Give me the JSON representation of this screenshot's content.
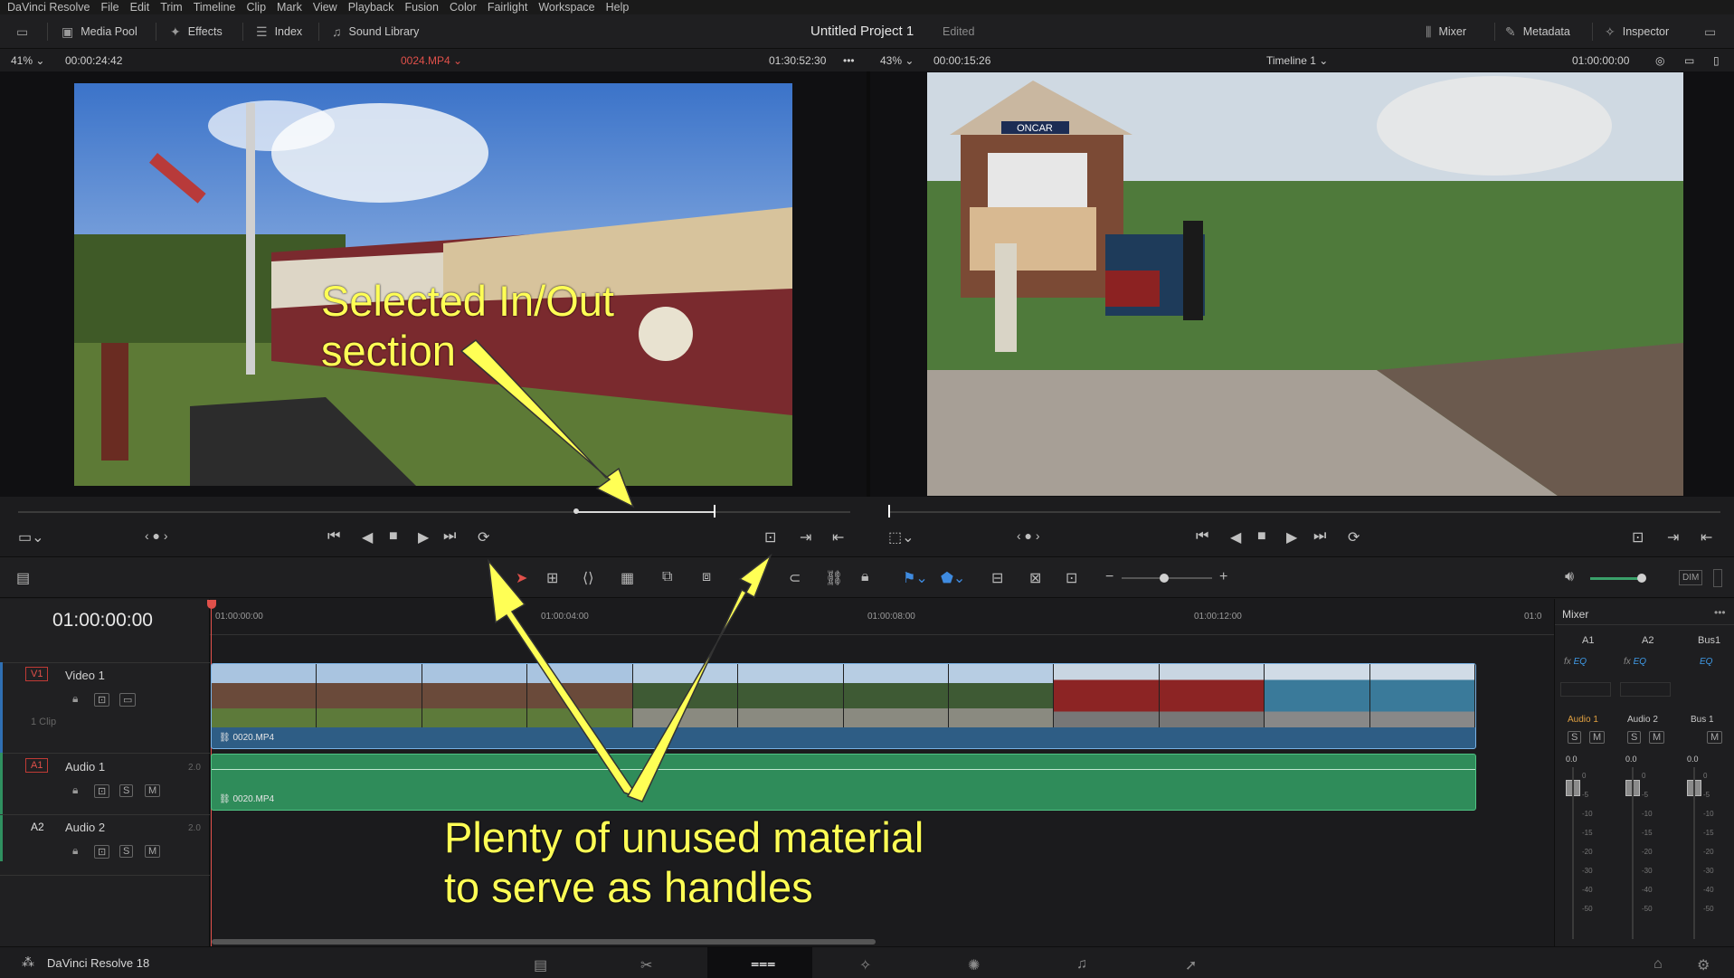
{
  "menu": [
    "DaVinci Resolve",
    "File",
    "Edit",
    "Trim",
    "Timeline",
    "Clip",
    "Mark",
    "View",
    "Playback",
    "Fusion",
    "Color",
    "Fairlight",
    "Workspace",
    "Help"
  ],
  "toolbar": {
    "media_pool": "Media Pool",
    "effects": "Effects",
    "index": "Index",
    "sound_library": "Sound Library",
    "project_title": "Untitled Project 1",
    "project_status": "Edited",
    "mixer": "Mixer",
    "metadata": "Metadata",
    "inspector": "Inspector"
  },
  "source_viewer": {
    "zoom": "41%",
    "duration": "00:00:24:42",
    "clip_name": "0024.MP4",
    "timecode": "01:30:52:30"
  },
  "timeline_viewer": {
    "zoom": "43%",
    "duration": "00:00:15:26",
    "timeline_name": "Timeline 1",
    "timecode": "01:00:00:00",
    "sign_text": "ONCAR"
  },
  "timeline": {
    "current_timecode": "01:00:00:00",
    "ruler_marks": [
      "01:00:00:00",
      "01:00:04:00",
      "01:00:08:00",
      "01:00:12:00",
      "01:0"
    ],
    "tracks": [
      {
        "id": "V1",
        "name": "Video 1",
        "info": "1 Clip",
        "clip": "0020.MP4"
      },
      {
        "id": "A1",
        "name": "Audio 1",
        "level": "2.0",
        "clip": "0020.MP4"
      },
      {
        "id": "A2",
        "name": "Audio 2",
        "level": "2.0"
      }
    ]
  },
  "mixer": {
    "title": "Mixer",
    "channels": [
      "A1",
      "A2",
      "Bus1"
    ],
    "fx_label": "fx",
    "eq_label": "EQ",
    "strips": [
      "Audio 1",
      "Audio 2",
      "Bus 1"
    ],
    "db_value": "0.0",
    "scale": [
      "0",
      "-5",
      "-10",
      "-15",
      "-20",
      "-30",
      "-40",
      "-50"
    ],
    "s": "S",
    "m": "M"
  },
  "dim_label": "DIM",
  "status": {
    "app": "DaVinci Resolve 18"
  },
  "annotations": {
    "top": [
      "Selected In/Out",
      "section"
    ],
    "bottom": [
      "Plenty of unused material",
      "to serve as handles"
    ]
  },
  "colors": {
    "accent_red": "#e0504a",
    "video_clip": "#2e5d85",
    "audio_clip": "#2f8c5a",
    "annotation": "#ffff55"
  }
}
